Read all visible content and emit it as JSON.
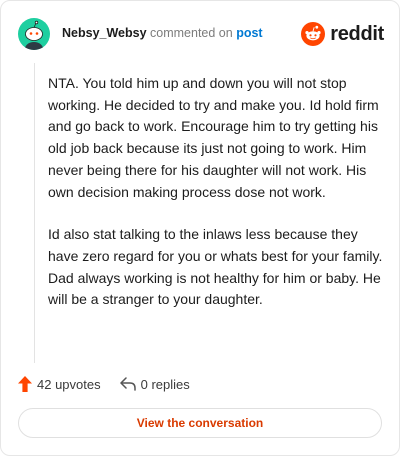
{
  "comment": {
    "username": "Nebsy_Websy",
    "action_text": "commented on",
    "post_link": "post",
    "paragraphs": [
      "NTA. You told him up and down you will not stop working. He decided to try and make you. Id hold firm and go back to work. Encourage him to try getting his old job back because its just not going to work. Him never being there for his daughter will not work. His own decision making process dose not work.",
      "Id also stat talking to the inlaws less because they have zero regard for you or whats best for your family. Dad always working is not healthy for him or baby. He will be a stranger to your daughter."
    ]
  },
  "brand": {
    "wordmark": "reddit",
    "color": "#ff4500"
  },
  "stats": {
    "upvotes": "42 upvotes",
    "replies": "0 replies"
  },
  "cta": {
    "label": "View the conversation"
  },
  "icons": {
    "upvote": "upvote-arrow-icon",
    "reply": "reply-arrow-icon",
    "logo": "reddit-snoo-icon"
  },
  "colors": {
    "accent": "#d93a00",
    "upvote": "#ff4500",
    "avatar": "#1ecfa0",
    "link": "#0079d3"
  }
}
